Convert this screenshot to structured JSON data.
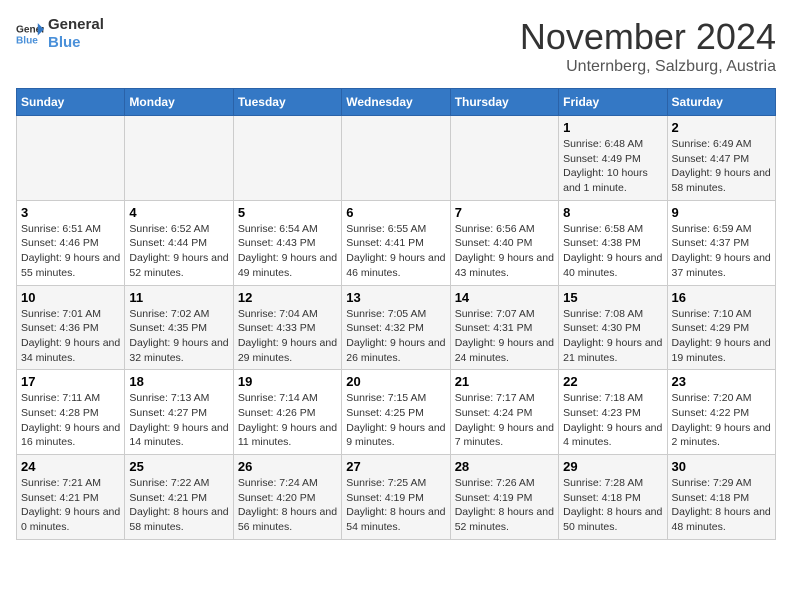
{
  "logo": {
    "line1": "General",
    "line2": "Blue"
  },
  "title": "November 2024",
  "location": "Unternberg, Salzburg, Austria",
  "days_of_week": [
    "Sunday",
    "Monday",
    "Tuesday",
    "Wednesday",
    "Thursday",
    "Friday",
    "Saturday"
  ],
  "weeks": [
    [
      {
        "day": "",
        "info": ""
      },
      {
        "day": "",
        "info": ""
      },
      {
        "day": "",
        "info": ""
      },
      {
        "day": "",
        "info": ""
      },
      {
        "day": "",
        "info": ""
      },
      {
        "day": "1",
        "info": "Sunrise: 6:48 AM\nSunset: 4:49 PM\nDaylight: 10 hours and 1 minute."
      },
      {
        "day": "2",
        "info": "Sunrise: 6:49 AM\nSunset: 4:47 PM\nDaylight: 9 hours and 58 minutes."
      }
    ],
    [
      {
        "day": "3",
        "info": "Sunrise: 6:51 AM\nSunset: 4:46 PM\nDaylight: 9 hours and 55 minutes."
      },
      {
        "day": "4",
        "info": "Sunrise: 6:52 AM\nSunset: 4:44 PM\nDaylight: 9 hours and 52 minutes."
      },
      {
        "day": "5",
        "info": "Sunrise: 6:54 AM\nSunset: 4:43 PM\nDaylight: 9 hours and 49 minutes."
      },
      {
        "day": "6",
        "info": "Sunrise: 6:55 AM\nSunset: 4:41 PM\nDaylight: 9 hours and 46 minutes."
      },
      {
        "day": "7",
        "info": "Sunrise: 6:56 AM\nSunset: 4:40 PM\nDaylight: 9 hours and 43 minutes."
      },
      {
        "day": "8",
        "info": "Sunrise: 6:58 AM\nSunset: 4:38 PM\nDaylight: 9 hours and 40 minutes."
      },
      {
        "day": "9",
        "info": "Sunrise: 6:59 AM\nSunset: 4:37 PM\nDaylight: 9 hours and 37 minutes."
      }
    ],
    [
      {
        "day": "10",
        "info": "Sunrise: 7:01 AM\nSunset: 4:36 PM\nDaylight: 9 hours and 34 minutes."
      },
      {
        "day": "11",
        "info": "Sunrise: 7:02 AM\nSunset: 4:35 PM\nDaylight: 9 hours and 32 minutes."
      },
      {
        "day": "12",
        "info": "Sunrise: 7:04 AM\nSunset: 4:33 PM\nDaylight: 9 hours and 29 minutes."
      },
      {
        "day": "13",
        "info": "Sunrise: 7:05 AM\nSunset: 4:32 PM\nDaylight: 9 hours and 26 minutes."
      },
      {
        "day": "14",
        "info": "Sunrise: 7:07 AM\nSunset: 4:31 PM\nDaylight: 9 hours and 24 minutes."
      },
      {
        "day": "15",
        "info": "Sunrise: 7:08 AM\nSunset: 4:30 PM\nDaylight: 9 hours and 21 minutes."
      },
      {
        "day": "16",
        "info": "Sunrise: 7:10 AM\nSunset: 4:29 PM\nDaylight: 9 hours and 19 minutes."
      }
    ],
    [
      {
        "day": "17",
        "info": "Sunrise: 7:11 AM\nSunset: 4:28 PM\nDaylight: 9 hours and 16 minutes."
      },
      {
        "day": "18",
        "info": "Sunrise: 7:13 AM\nSunset: 4:27 PM\nDaylight: 9 hours and 14 minutes."
      },
      {
        "day": "19",
        "info": "Sunrise: 7:14 AM\nSunset: 4:26 PM\nDaylight: 9 hours and 11 minutes."
      },
      {
        "day": "20",
        "info": "Sunrise: 7:15 AM\nSunset: 4:25 PM\nDaylight: 9 hours and 9 minutes."
      },
      {
        "day": "21",
        "info": "Sunrise: 7:17 AM\nSunset: 4:24 PM\nDaylight: 9 hours and 7 minutes."
      },
      {
        "day": "22",
        "info": "Sunrise: 7:18 AM\nSunset: 4:23 PM\nDaylight: 9 hours and 4 minutes."
      },
      {
        "day": "23",
        "info": "Sunrise: 7:20 AM\nSunset: 4:22 PM\nDaylight: 9 hours and 2 minutes."
      }
    ],
    [
      {
        "day": "24",
        "info": "Sunrise: 7:21 AM\nSunset: 4:21 PM\nDaylight: 9 hours and 0 minutes."
      },
      {
        "day": "25",
        "info": "Sunrise: 7:22 AM\nSunset: 4:21 PM\nDaylight: 8 hours and 58 minutes."
      },
      {
        "day": "26",
        "info": "Sunrise: 7:24 AM\nSunset: 4:20 PM\nDaylight: 8 hours and 56 minutes."
      },
      {
        "day": "27",
        "info": "Sunrise: 7:25 AM\nSunset: 4:19 PM\nDaylight: 8 hours and 54 minutes."
      },
      {
        "day": "28",
        "info": "Sunrise: 7:26 AM\nSunset: 4:19 PM\nDaylight: 8 hours and 52 minutes."
      },
      {
        "day": "29",
        "info": "Sunrise: 7:28 AM\nSunset: 4:18 PM\nDaylight: 8 hours and 50 minutes."
      },
      {
        "day": "30",
        "info": "Sunrise: 7:29 AM\nSunset: 4:18 PM\nDaylight: 8 hours and 48 minutes."
      }
    ]
  ]
}
